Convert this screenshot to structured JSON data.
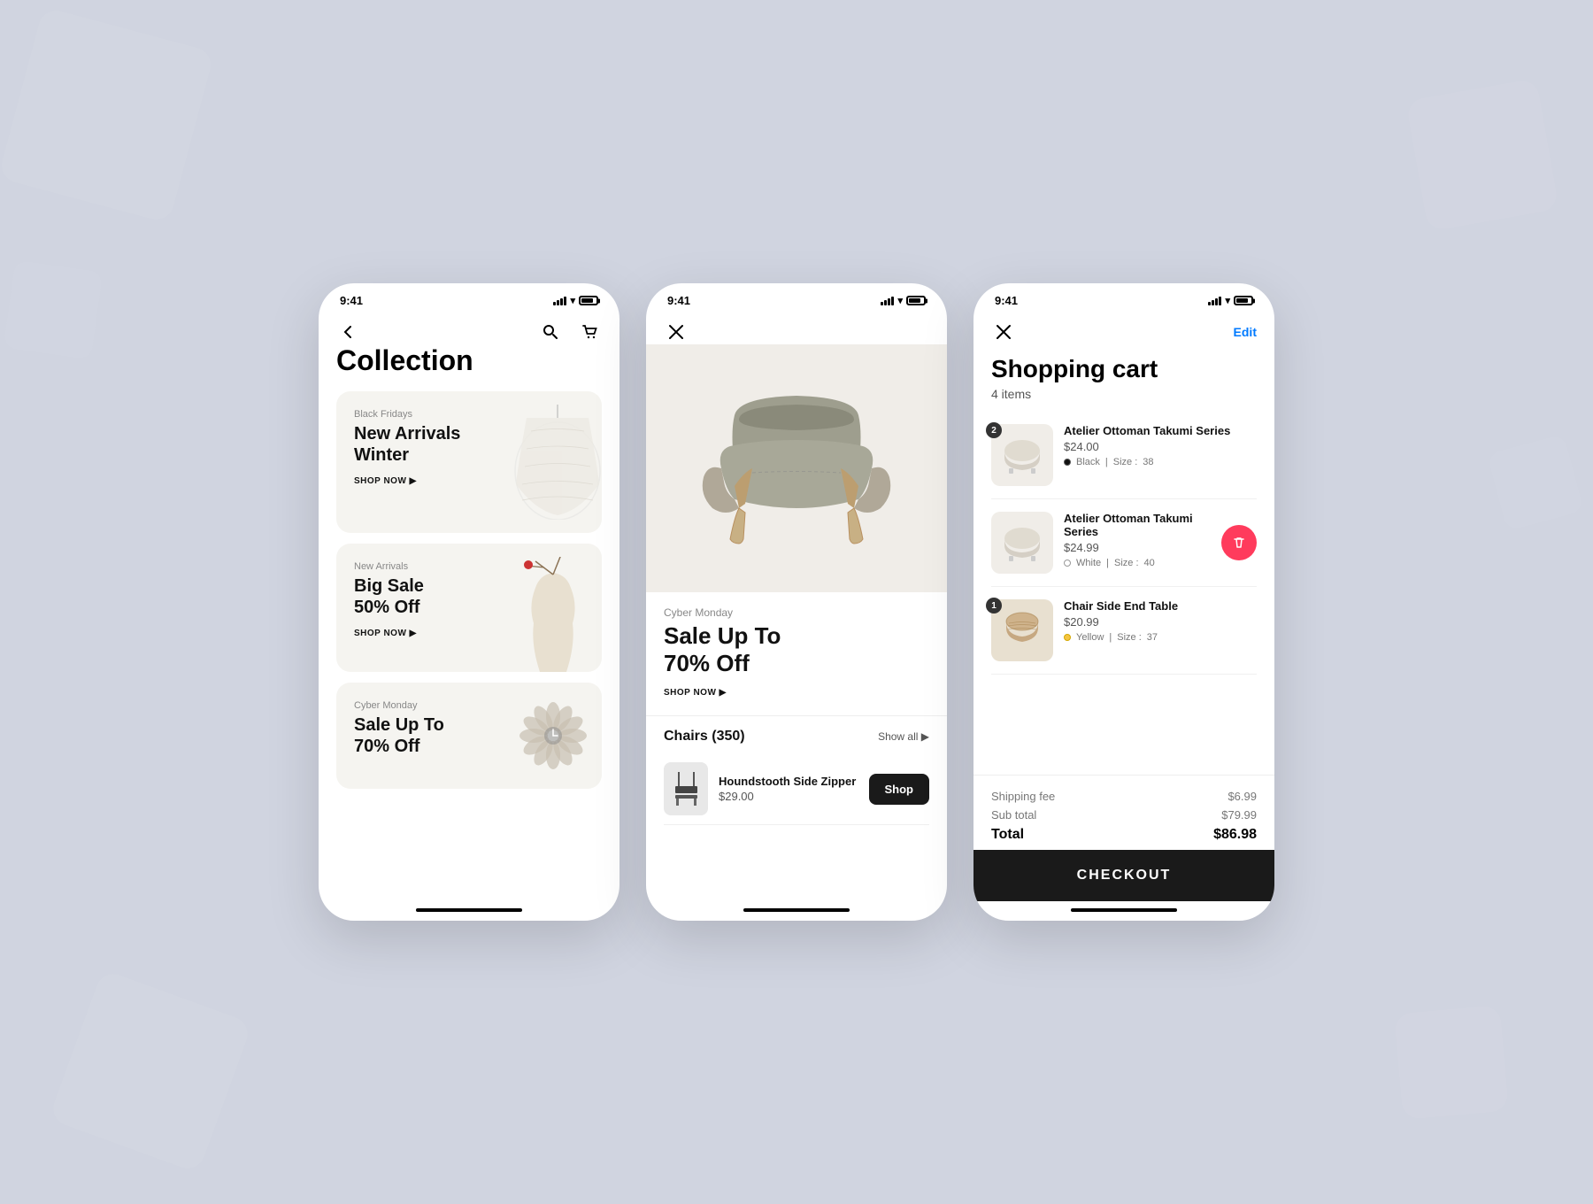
{
  "bg": {
    "color": "#c8ccdb"
  },
  "phone1": {
    "status": {
      "time": "9:41"
    },
    "title": "Collection",
    "cards": [
      {
        "label": "Black Fridays",
        "title": "New Arrivals\nWinter",
        "cta": "SHOP NOW ▶",
        "img": "lamp"
      },
      {
        "label": "New Arrivals",
        "title": "Big Sale\n50% Off",
        "cta": "SHOP NOW ▶",
        "img": "vase"
      },
      {
        "label": "Cyber Monday",
        "title": "Sale Up To\n70% Off",
        "cta": "",
        "img": "flower"
      }
    ]
  },
  "phone2": {
    "status": {
      "time": "9:41"
    },
    "product": {
      "sublabel": "Cyber Monday",
      "sale_title": "Sale Up To\n70% Off",
      "cta": "SHOP NOW ▶"
    },
    "chairs_section": {
      "title": "Chairs (350)",
      "show_all": "Show all ▶",
      "items": [
        {
          "name": "Houndstooth Side Zipper",
          "price": "$29.00",
          "cta": "Shop"
        }
      ]
    }
  },
  "phone3": {
    "status": {
      "time": "9:41"
    },
    "edit_label": "Edit",
    "title": "Shopping cart",
    "count": "4 items",
    "items": [
      {
        "name": "Atelier Ottoman Takumi Series",
        "price": "$24.00",
        "color_name": "Black",
        "size": "38",
        "quantity": "2",
        "color_hex": "#111111",
        "has_delete": false
      },
      {
        "name": "Atelier Ottoman Takumi Series",
        "price": "$24.99",
        "color_name": "White",
        "size": "40",
        "quantity": "",
        "color_hex": "#ffffff",
        "has_delete": true
      },
      {
        "name": "Chair Side End Table",
        "price": "$20.99",
        "color_name": "Yellow",
        "size": "37",
        "quantity": "1",
        "color_hex": "#f5c542",
        "has_delete": false
      }
    ],
    "summary": {
      "shipping_label": "Shipping fee",
      "shipping_value": "$6.99",
      "subtotal_label": "Sub total",
      "subtotal_value": "$79.99",
      "total_label": "Total",
      "total_value": "$86.98"
    },
    "checkout_label": "CHECKOUT"
  }
}
